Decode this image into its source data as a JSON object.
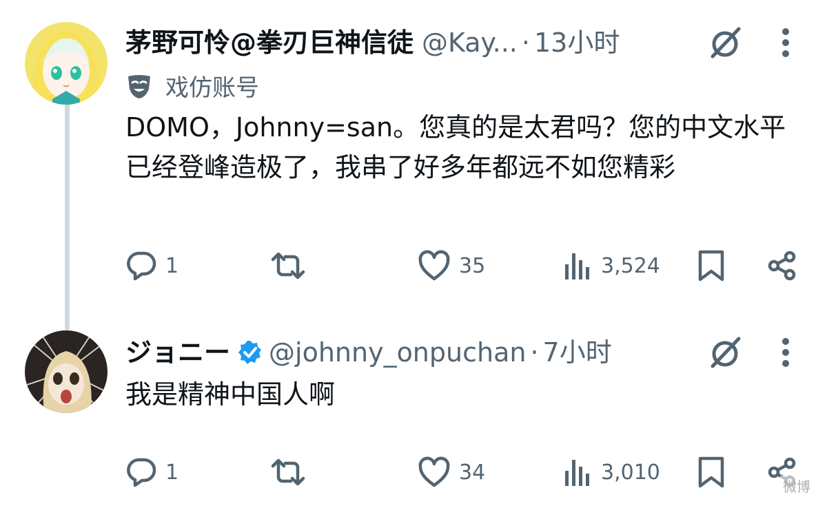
{
  "tweet1": {
    "name": "茅野可怜@拳刃巨神信徒",
    "handle": "@Kay...",
    "time": "13小时",
    "parody_label": "戏仿账号",
    "text": "DOMO，Johnny=san。您真的是太君吗？您的中文水平已经登峰造极了，我串了好多年都远不如您精彩",
    "replies": "1",
    "likes": "35",
    "views": "3,524"
  },
  "tweet2": {
    "name": "ジョニー",
    "handle": "@johnny_onpuchan",
    "time": "7小时",
    "text": "我是精神中国人啊",
    "replies": "1",
    "likes": "34",
    "views": "3,010"
  },
  "separator": "·",
  "watermark": "微博",
  "colors": {
    "text": "#0f1419",
    "secondary": "#536471",
    "thread_line": "#cfd9de",
    "verified": "#1d9bf0"
  },
  "icons": [
    "grok-icon",
    "more-icon",
    "mask-icon",
    "verified-icon",
    "reply-icon",
    "retweet-icon",
    "like-icon",
    "views-icon",
    "bookmark-icon",
    "share-icon"
  ]
}
